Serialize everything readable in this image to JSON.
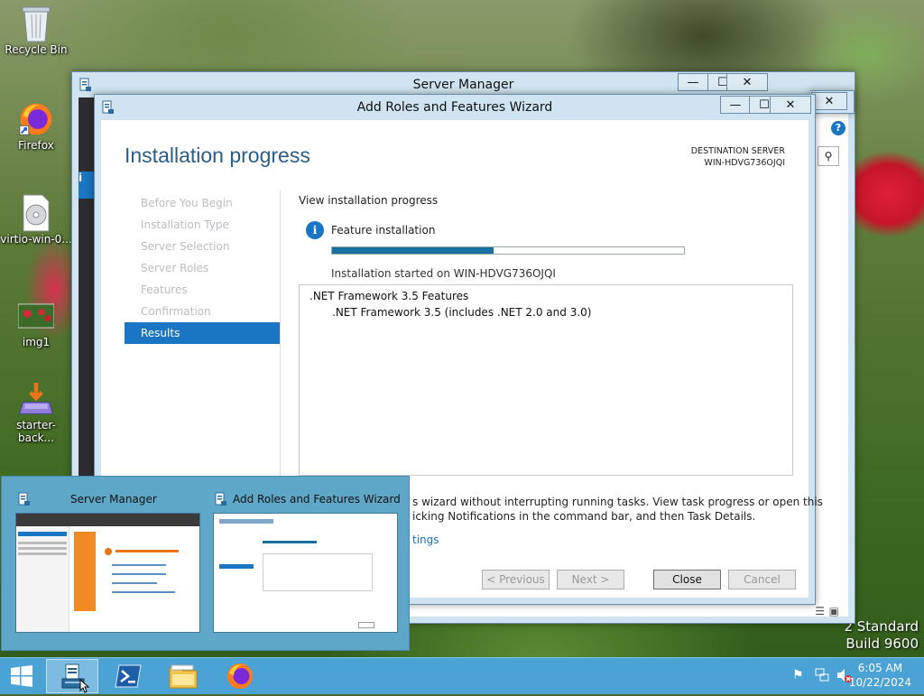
{
  "desktop": {
    "icons": [
      {
        "label": "Recycle Bin"
      },
      {
        "label": "Firefox"
      },
      {
        "label": "virtio-win-0..."
      },
      {
        "label": "img1"
      },
      {
        "label": "starter-back..."
      }
    ],
    "watermark_line1": "2 Standard",
    "watermark_line2": "Build 9600"
  },
  "server_manager": {
    "title": "Server Manager"
  },
  "wizard": {
    "title": "Add Roles and Features Wizard",
    "page_heading": "Installation progress",
    "destination_label": "DESTINATION SERVER",
    "destination_server": "WIN-HDVG736OJQI",
    "steps": [
      {
        "label": "Before You Begin",
        "active": false
      },
      {
        "label": "Installation Type",
        "active": false
      },
      {
        "label": "Server Selection",
        "active": false
      },
      {
        "label": "Server Roles",
        "active": false
      },
      {
        "label": "Features",
        "active": false
      },
      {
        "label": "Confirmation",
        "active": false
      },
      {
        "label": "Results",
        "active": true
      }
    ],
    "view_progress_label": "View installation progress",
    "status_title": "Feature installation",
    "progress_fraction": 0.46,
    "status_detail": "Installation started on WIN-HDVG736OJQI",
    "features": [
      {
        "label": ".NET Framework 3.5 Features",
        "indent": 0
      },
      {
        "label": ".NET Framework 3.5 (includes .NET 2.0 and 3.0)",
        "indent": 1
      }
    ],
    "note_line1": "s wizard without interrupting running tasks. View task progress or open this",
    "note_line2": "icking Notifications in the command bar, and then Task Details.",
    "export_link": "tings",
    "buttons": {
      "previous": "< Previous",
      "next": "Next >",
      "close": "Close",
      "cancel": "Cancel"
    }
  },
  "flyout": {
    "thumb1_title": "Server Manager",
    "thumb2_title": "Add Roles and Features Wizard"
  },
  "taskbar": {
    "time": "6:05 AM",
    "date": "10/22/2024"
  },
  "colors": {
    "accent": "#1a75c2",
    "taskbar": "#4ba2d4",
    "window_frame": "#cfe4f0"
  }
}
